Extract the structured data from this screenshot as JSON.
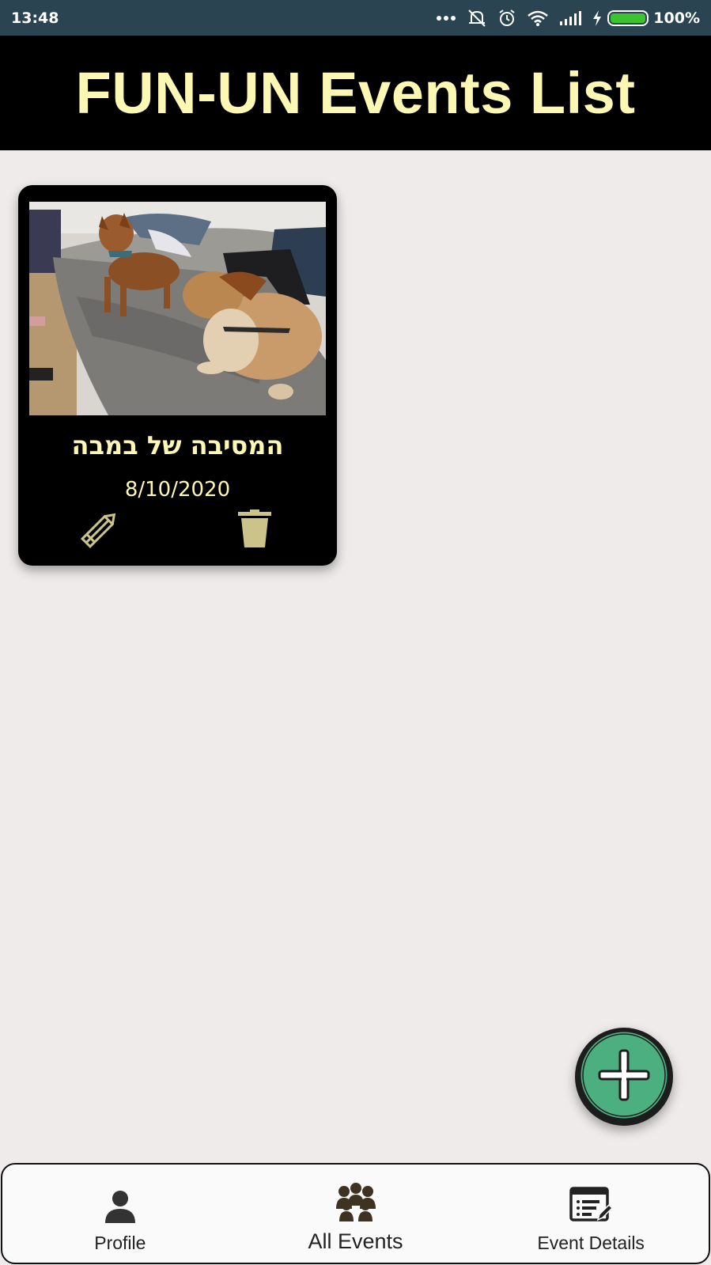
{
  "status_bar": {
    "time": "13:48",
    "battery_percent": "100%",
    "battery_level": 1.0,
    "icons": [
      "more-dots-icon",
      "vibrate-off-icon",
      "alarm-icon",
      "wifi-icon",
      "signal-icon",
      "charging-icon",
      "battery-icon"
    ]
  },
  "header": {
    "title": "FUN-UN Events List"
  },
  "events": [
    {
      "name": "המסיבה של במבה",
      "date": "8/10/2020",
      "image": "dogs-on-couch-photo",
      "edit_icon": "pencil-icon",
      "delete_icon": "trash-icon"
    }
  ],
  "fab": {
    "icon": "plus-icon"
  },
  "bottom_nav": {
    "items": [
      {
        "label": "Profile",
        "icon": "person-icon"
      },
      {
        "label": "All Events",
        "icon": "people-group-icon",
        "active": true
      },
      {
        "label": "Event Details",
        "icon": "list-edit-icon"
      }
    ]
  },
  "colors": {
    "status_bar": "#2b4452",
    "header_bg": "#000000",
    "accent_text": "#fdf7b4",
    "icon_tan": "#cbc38a",
    "fab_green": "#4caf80",
    "page_bg": "#efebeb"
  }
}
